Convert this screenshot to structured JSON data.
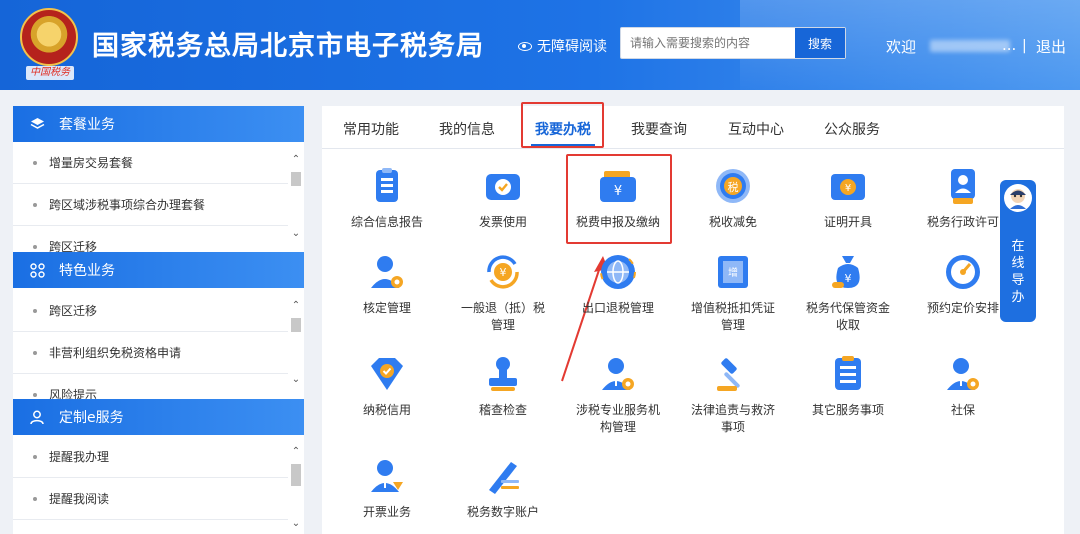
{
  "header": {
    "title": "国家税务总局北京市电子税务局",
    "emblem_text": "中国税务",
    "accessibility_label": "无障碍阅读",
    "search_placeholder": "请输入需要搜索的内容",
    "search_button": "搜索",
    "welcome": "欢迎",
    "ellipsis": "...",
    "separator": "|",
    "logout": "退出"
  },
  "sidebar": {
    "sections": [
      {
        "title": "套餐业务",
        "icon": "layers-icon",
        "items": [
          "增量房交易套餐",
          "跨区域涉税事项综合办理套餐",
          "跨区迁移"
        ]
      },
      {
        "title": "特色业务",
        "icon": "grid-icon",
        "items": [
          "跨区迁移",
          "非营利组织免税资格申请",
          "风险提示"
        ]
      },
      {
        "title": "定制e服务",
        "icon": "user-icon",
        "items": [
          "提醒我办理",
          "提醒我阅读"
        ]
      }
    ]
  },
  "tabs": [
    "常用功能",
    "我的信息",
    "我要办税",
    "我要查询",
    "互动中心",
    "公众服务"
  ],
  "active_tab": "我要办税",
  "tiles": [
    {
      "label": "综合信息报告",
      "icon": "report-icon"
    },
    {
      "label": "发票使用",
      "icon": "invoice-icon"
    },
    {
      "label": "税费申报及缴纳",
      "icon": "wallet-icon"
    },
    {
      "label": "税收减免",
      "icon": "tax-relief-icon"
    },
    {
      "label": "证明开具",
      "icon": "certificate-icon"
    },
    {
      "label": "税务行政许可",
      "icon": "license-icon"
    },
    {
      "label": "核定管理",
      "icon": "user-gear-icon"
    },
    {
      "label": "一般退（抵）税管理",
      "icon": "refund-icon"
    },
    {
      "label": "出口退税管理",
      "icon": "globe-icon"
    },
    {
      "label": "增值税抵扣凭证管理",
      "icon": "vat-ticket-icon"
    },
    {
      "label": "税务代保管资金收取",
      "icon": "money-bag-icon"
    },
    {
      "label": "预约定价安排",
      "icon": "gauge-icon"
    },
    {
      "label": "纳税信用",
      "icon": "diamond-icon"
    },
    {
      "label": "稽查检查",
      "icon": "stamp-icon"
    },
    {
      "label": "涉税专业服务机构管理",
      "icon": "agent-gear-icon"
    },
    {
      "label": "法律追责与救济事项",
      "icon": "gavel-icon"
    },
    {
      "label": "其它服务事项",
      "icon": "list-icon"
    },
    {
      "label": "社保",
      "icon": "social-security-icon"
    },
    {
      "label": "开票业务",
      "icon": "issuer-icon"
    },
    {
      "label": "税务数字账户",
      "icon": "digital-account-icon"
    }
  ],
  "tile_label_lines": {
    "一般退（抵）税管理": [
      "一般退（抵）税",
      "管理"
    ],
    "增值税抵扣凭证管理": [
      "增值税抵扣凭证",
      "管理"
    ],
    "税务代保管资金收取": [
      "税务代保管资金",
      "收取"
    ],
    "涉税专业服务机构管理": [
      "涉税专业服务机",
      "构管理"
    ],
    "法律追责与救济事项": [
      "法律追责与救济",
      "事项"
    ]
  },
  "guide": {
    "label": "在线导办"
  },
  "colors": {
    "brand": "#1766d8",
    "highlight": "#e33a32",
    "icon_blue": "#2f7cf0",
    "icon_orange": "#f5a623"
  }
}
